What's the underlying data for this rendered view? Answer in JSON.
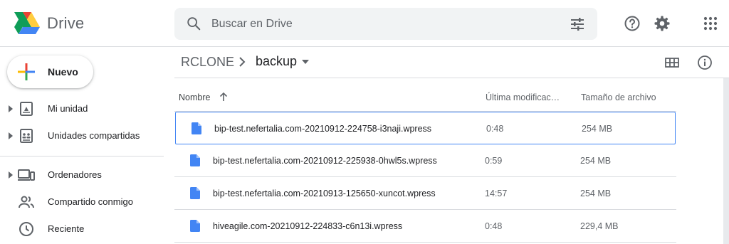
{
  "header": {
    "app_name": "Drive",
    "search": {
      "placeholder": "Buscar en Drive"
    },
    "icons": [
      "search-icon",
      "tune-icon",
      "help-icon",
      "settings-icon",
      "apps-icon"
    ]
  },
  "sidebar": {
    "new_button": {
      "label": "Nuevo"
    },
    "items": [
      {
        "label": "Mi unidad",
        "icon": "my-drive-icon",
        "expandable": true
      },
      {
        "label": "Unidades compartidas",
        "icon": "shared-drives-icon",
        "expandable": true
      },
      {
        "label": "Ordenadores",
        "icon": "computers-icon",
        "expandable": true
      },
      {
        "label": "Compartido conmigo",
        "icon": "shared-with-me-icon",
        "expandable": false
      },
      {
        "label": "Reciente",
        "icon": "recent-icon",
        "expandable": false
      }
    ]
  },
  "breadcrumb": {
    "root": "RCLONE",
    "current": "backup"
  },
  "file_list": {
    "columns": {
      "name": "Nombre",
      "modified": "Última modificac…",
      "size": "Tamaño de archivo"
    },
    "sort": {
      "column": "name",
      "direction": "ascending"
    },
    "rows": [
      {
        "name": "bip-test.nefertalia.com-20210912-224758-i3naji.wpress",
        "modified": "0:48",
        "size": "254 MB",
        "selected": true
      },
      {
        "name": "bip-test.nefertalia.com-20210912-225938-0hwl5s.wpress",
        "modified": "0:59",
        "size": "254 MB",
        "selected": false
      },
      {
        "name": "bip-test.nefertalia.com-20210913-125650-xuncot.wpress",
        "modified": "14:57",
        "size": "254 MB",
        "selected": false
      },
      {
        "name": "hiveagile.com-20210912-224833-c6n13i.wpress",
        "modified": "0:48",
        "size": "229,4 MB",
        "selected": false
      }
    ]
  },
  "colors": {
    "accent_blue": "#4285f4",
    "file_icon_blue": "#4285f4",
    "divider": "#dadce0",
    "search_bg": "#f1f3f4",
    "muted_text": "#5f6368"
  }
}
